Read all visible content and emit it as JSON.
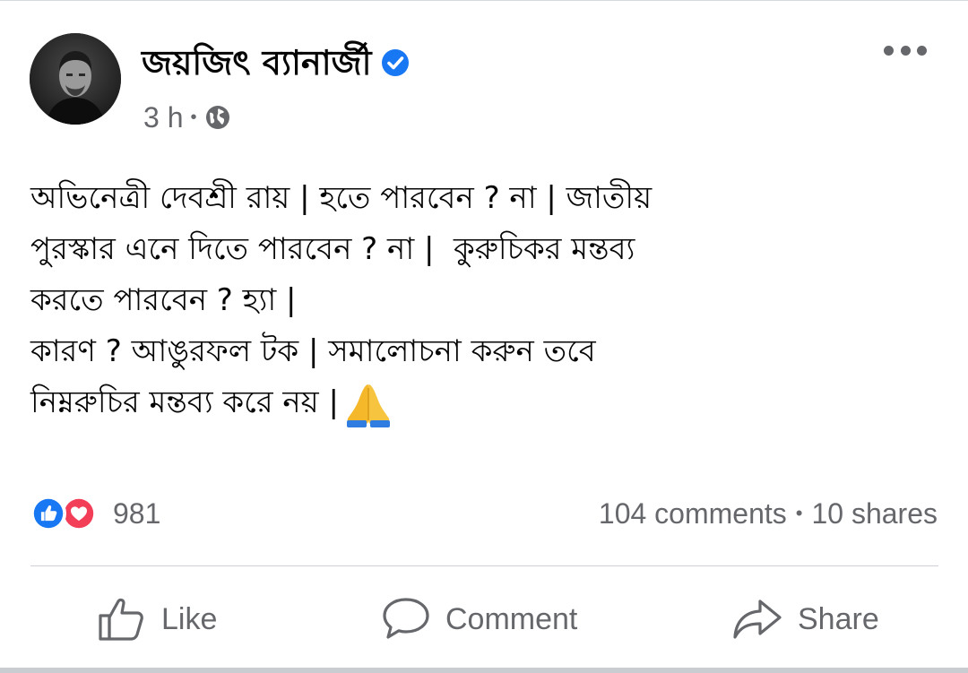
{
  "post": {
    "author_name": "জয়জিৎ ব্যানার্জী",
    "time": "3 h",
    "separator": "•",
    "lines": [
      "অভিনেত্রী দেবশ্রী রায় | হতে পারবেন ? না | জাতীয়",
      "পুরস্কার এনে দিতে পারবেন ? না |  কুরুচিকর মন্তব্য",
      "করতে পারবেন ? হ্যা |",
      "কারণ ? আঙুরফল টক | সমালোচনা করুন তবে",
      "নিম্নরুচির মন্তব্য করে নয় |"
    ]
  },
  "stats": {
    "reaction_count": "981",
    "comments": "104 comments",
    "dot": "•",
    "shares": "10 shares"
  },
  "actions": {
    "like": "Like",
    "comment": "Comment",
    "share": "Share"
  },
  "colors": {
    "facebook_blue": "#1877f2",
    "love_red": "#f33e58",
    "muted_text": "#65676b",
    "verified_blue": "#1877f2"
  },
  "icons": {
    "verified": "verified-badge-icon",
    "globe": "globe-icon",
    "more": "more-options-icon",
    "like_reaction": "like-reaction-icon",
    "love_reaction": "love-reaction-icon",
    "pray": "folded-hands-emoji",
    "like_action": "thumbs-up-icon",
    "comment_action": "speech-bubble-icon",
    "share_action": "share-arrow-icon"
  }
}
